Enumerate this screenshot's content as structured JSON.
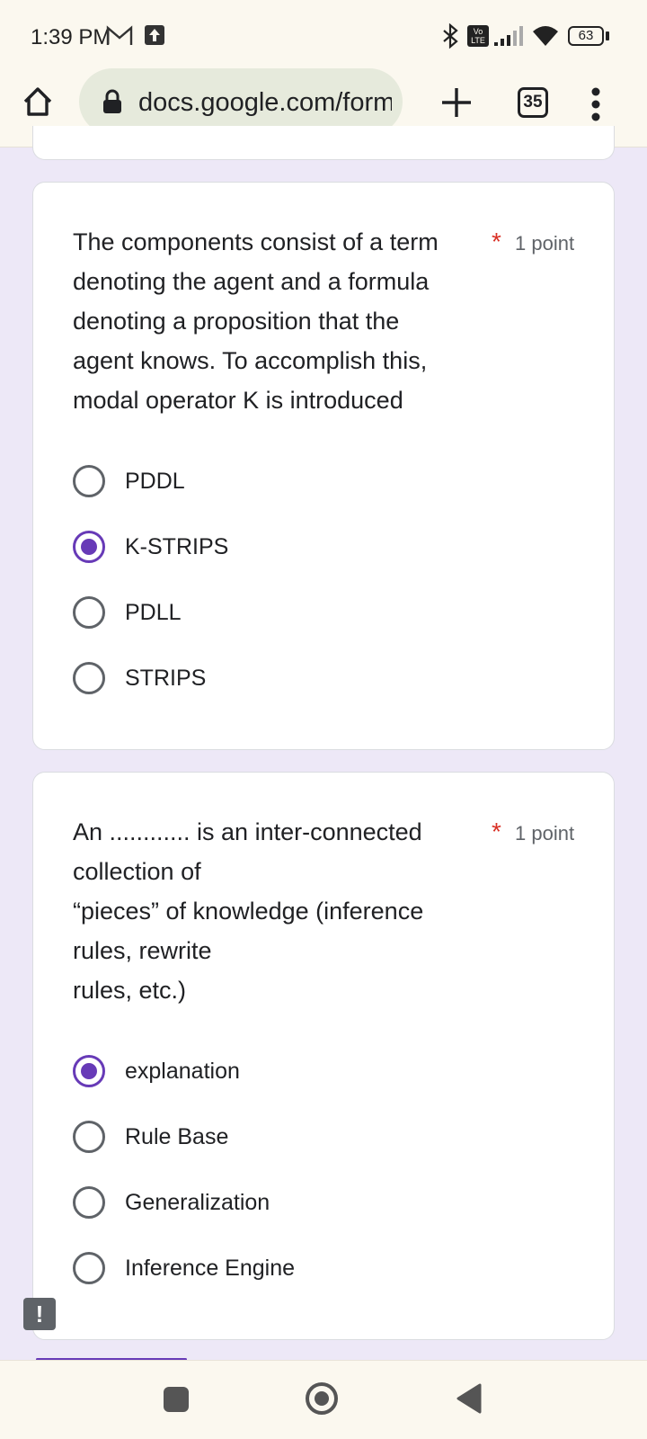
{
  "status_bar": {
    "time": "1:39 PM",
    "battery": "63",
    "icons": [
      "gmail-icon",
      "upload-icon",
      "bluetooth-icon",
      "volte-icon",
      "signal-icon",
      "wifi-icon",
      "battery-icon"
    ],
    "volte_label": "Vo LTE"
  },
  "browser": {
    "url": "docs.google.com/forms",
    "tab_count": "35",
    "icons": [
      "home-icon",
      "lock-icon",
      "new-tab-icon",
      "menu-icon"
    ]
  },
  "questions": [
    {
      "text_lines": [
        "The components consist of a term",
        "denoting the agent and a formula",
        "denoting a proposition that the",
        "agent knows. To accomplish this,",
        "modal operator K is introduced"
      ],
      "required_mark": "*",
      "points": "1 point",
      "options": [
        {
          "label": "PDDL",
          "selected": false
        },
        {
          "label": "K-STRIPS",
          "selected": true
        },
        {
          "label": "PDLL",
          "selected": false
        },
        {
          "label": "STRIPS",
          "selected": false
        }
      ]
    },
    {
      "text_lines": [
        "An ............ is an inter-connected",
        "collection of",
        "“pieces” of knowledge (inference",
        "rules, rewrite",
        "rules, etc.)"
      ],
      "required_mark": "*",
      "points": "1 point",
      "options": [
        {
          "label": "explanation",
          "selected": true
        },
        {
          "label": "Rule Base",
          "selected": false
        },
        {
          "label": "Generalization",
          "selected": false
        },
        {
          "label": "Inference Engine",
          "selected": false
        }
      ]
    }
  ],
  "feedback_badge": "!",
  "nav_bar": {
    "icons": [
      "recents-icon",
      "home-circle-icon",
      "back-icon"
    ]
  },
  "colors": {
    "accent": "#673ab7",
    "required": "#d93025",
    "page_bg": "#ede8f7"
  }
}
